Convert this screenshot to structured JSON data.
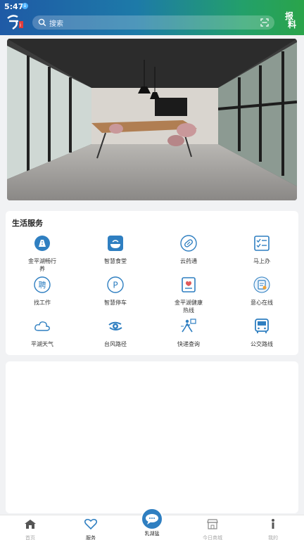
{
  "status": {
    "time": "5:47",
    "notice": "↓"
  },
  "header": {
    "search_placeholder": "搜索",
    "report_label_line1": "报",
    "report_label_line2": "料"
  },
  "section": {
    "title": "生活服务"
  },
  "services": [
    {
      "label": "金平湖畅行养",
      "icon": "traffic-icon"
    },
    {
      "label": "智慧食堂",
      "icon": "canteen-icon"
    },
    {
      "label": "云药通",
      "icon": "pill-icon"
    },
    {
      "label": "马上办",
      "icon": "checklist-icon"
    },
    {
      "label": "找工作",
      "icon": "job-icon"
    },
    {
      "label": "智慧停车",
      "icon": "parking-icon"
    },
    {
      "label": "金平湖健康热线",
      "icon": "health-hotline-icon"
    },
    {
      "label": "意心在线",
      "icon": "note-icon"
    },
    {
      "label": "平湖天气",
      "icon": "cloud-icon"
    },
    {
      "label": "台风路径",
      "icon": "typhoon-icon"
    },
    {
      "label": "快递查询",
      "icon": "courier-icon"
    },
    {
      "label": "公交路线",
      "icon": "bus-icon"
    }
  ],
  "tabs": [
    {
      "label": "首页",
      "icon": "home-icon"
    },
    {
      "label": "服务",
      "icon": "heart-icon",
      "active": true
    },
    {
      "label": "乳湖猛",
      "icon": "chat-bubble-icon"
    },
    {
      "label": "今日商城",
      "icon": "shop-icon"
    },
    {
      "label": "我的",
      "icon": "user-info-icon"
    }
  ],
  "colors": {
    "accent": "#2f7fc1",
    "header_start": "#1f5aa6",
    "header_end": "#2aa44a"
  }
}
